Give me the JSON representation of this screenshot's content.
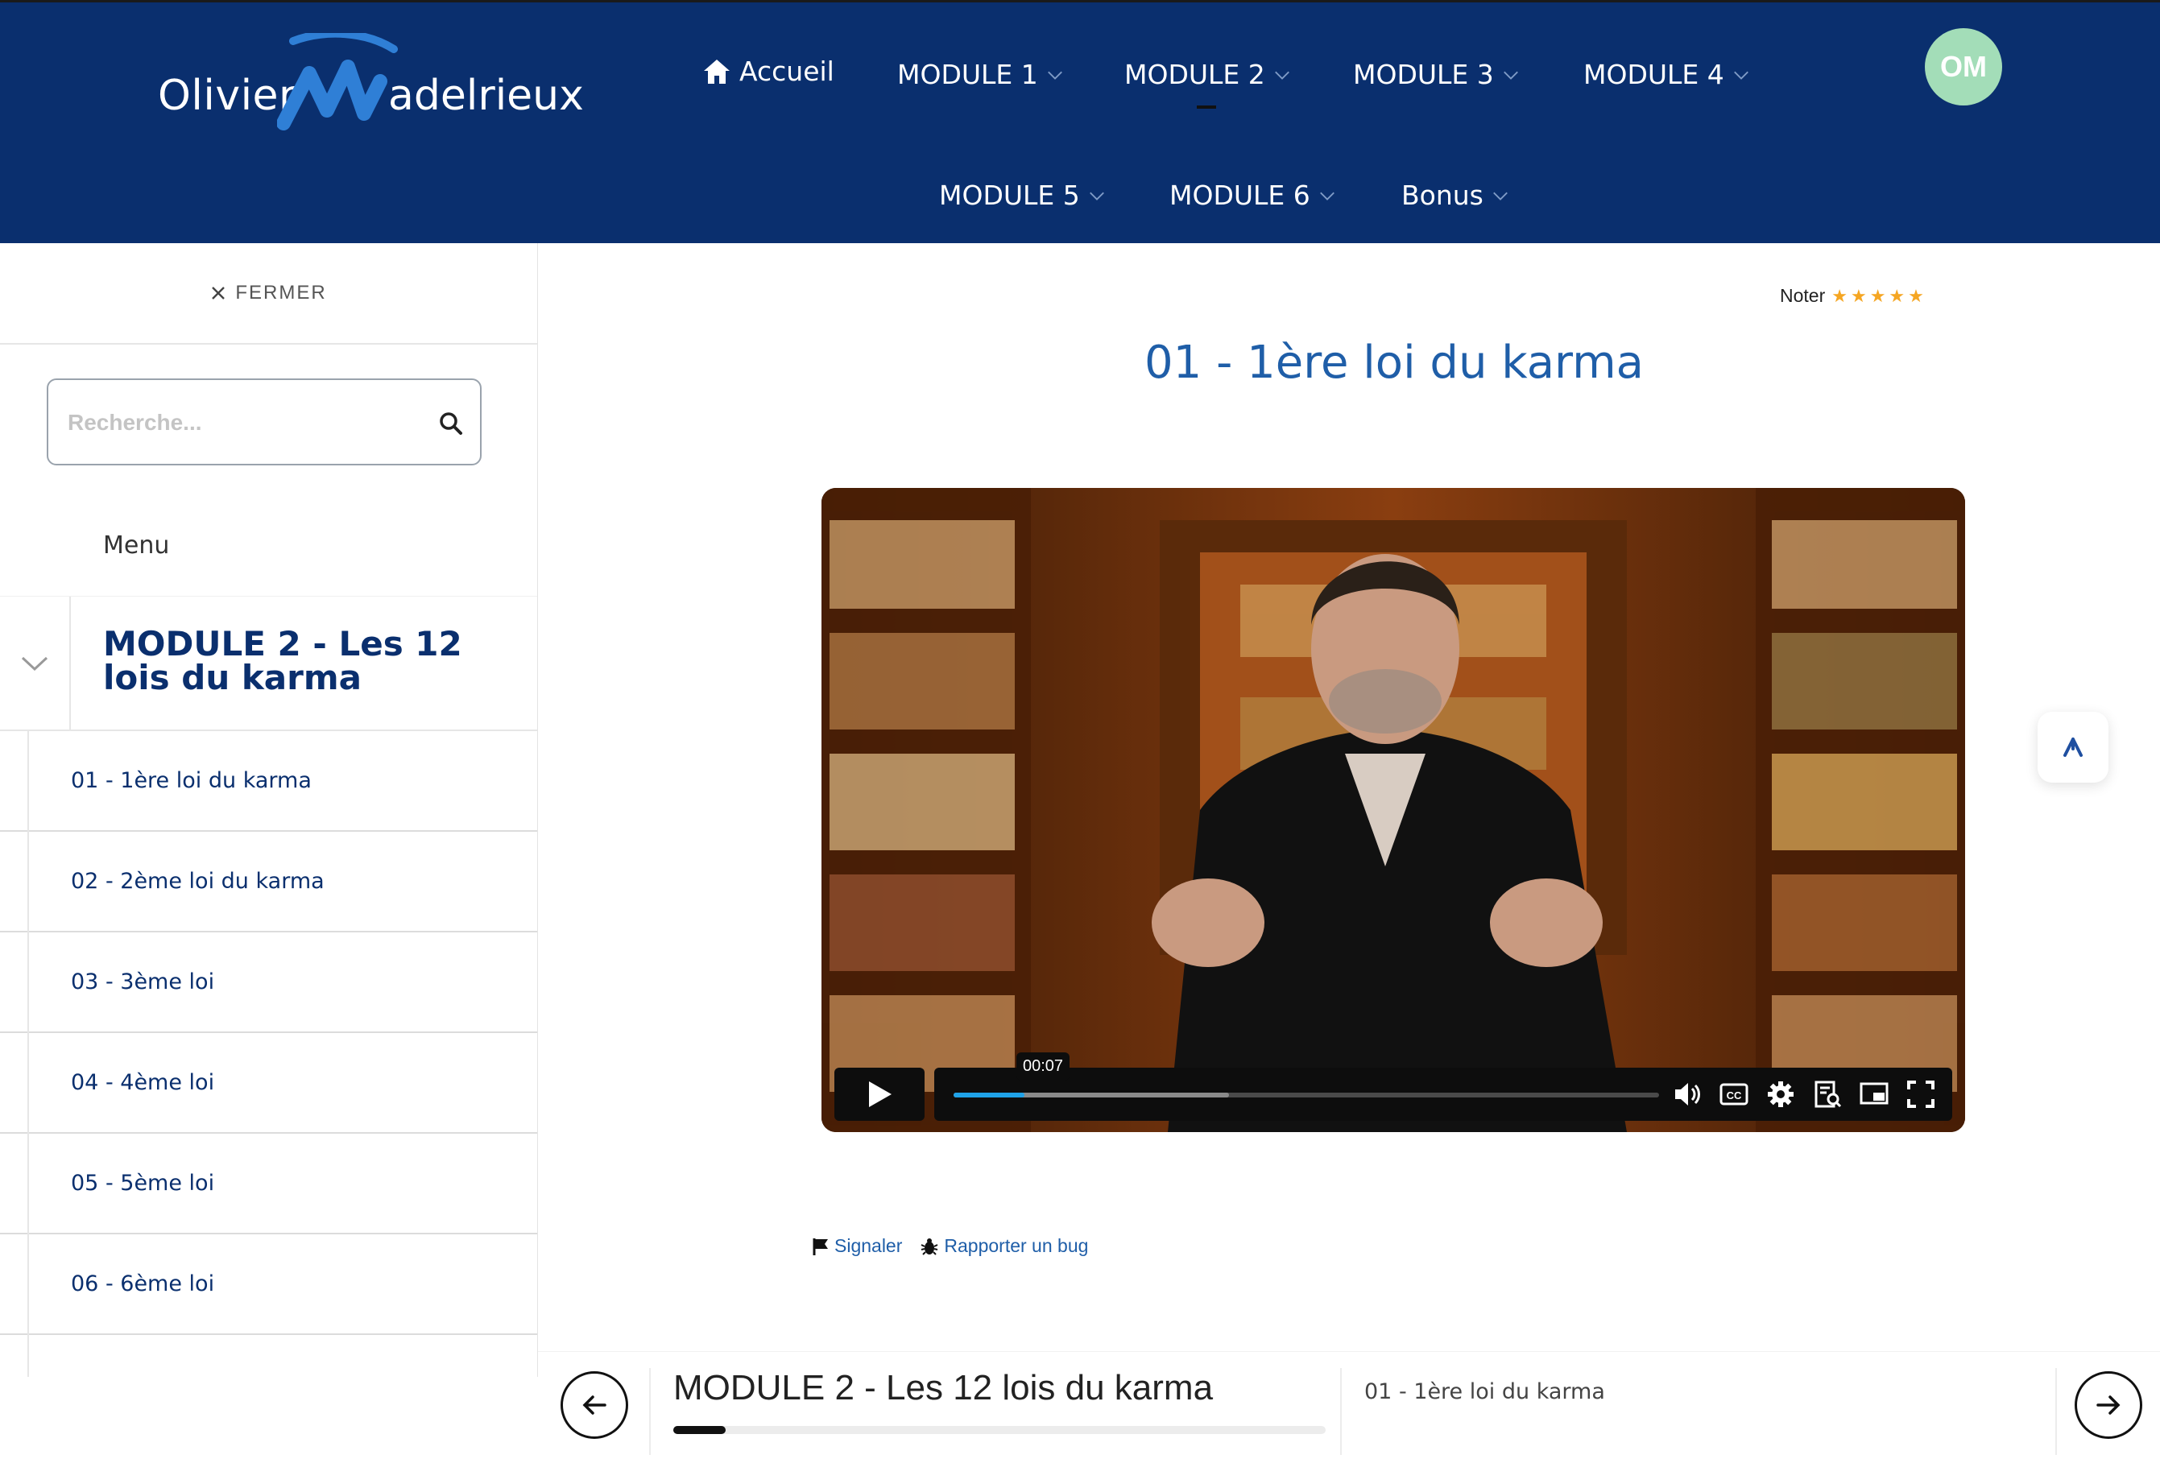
{
  "brand": {
    "logo_part1": "Olivier",
    "logo_part2": "adelrieux"
  },
  "nav": {
    "items": [
      {
        "label": "Accueil"
      },
      {
        "label": "MODULE 1"
      },
      {
        "label": "MODULE 2"
      },
      {
        "label": "MODULE 3"
      },
      {
        "label": "MODULE 4"
      },
      {
        "label": "MODULE 5"
      },
      {
        "label": "MODULE 6"
      },
      {
        "label": "Bonus"
      }
    ],
    "avatar_initials": "OM"
  },
  "sidebar": {
    "close_label": "FERMER",
    "search_placeholder": "Recherche...",
    "menu_label": "Menu",
    "module_title": "MODULE 2 - Les 12 lois du karma",
    "lessons": [
      {
        "label": "01 - 1ère loi du karma"
      },
      {
        "label": "02 - 2ème loi du karma"
      },
      {
        "label": "03 - 3ème loi"
      },
      {
        "label": "04 - 4ème loi"
      },
      {
        "label": "05 - 5ème loi"
      },
      {
        "label": "06 - 6ème loi"
      }
    ]
  },
  "main": {
    "rating_label": "Noter",
    "stars": "★★★★★",
    "lesson_title": "01 - 1ère loi du karma",
    "video": {
      "time_tooltip": "00:07",
      "played_fraction": 0.1,
      "buffered_fraction": 0.39
    },
    "links": {
      "report": "Signaler",
      "bug": "Rapporter un bug"
    },
    "bottom": {
      "module_title": "MODULE 2 - Les 12 lois du karma",
      "current_lesson": "01 - 1ère loi du karma",
      "progress_fraction": 0.08
    }
  },
  "colors": {
    "header": "#0a2f6e",
    "accent": "#1f5ea8",
    "avatar": "#a3ddb8",
    "stars": "#f5a623",
    "progress": "#1fa2e8"
  }
}
